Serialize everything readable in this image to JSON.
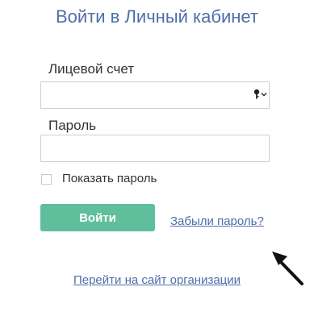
{
  "page": {
    "title": "Войти в Личный кабинет"
  },
  "form": {
    "account_label": "Лицевой счет",
    "account_value": "",
    "password_label": "Пароль",
    "password_value": "",
    "show_password_label": "Показать пароль",
    "show_password_checked": false,
    "submit_label": "Войти",
    "forgot_link": "Забыли пароль?"
  },
  "footer": {
    "org_link": "Перейти на сайт организации"
  },
  "icons": {
    "autofill": "key-icon",
    "pointer": "arrow-annotation-icon"
  },
  "colors": {
    "accent": "#4e6ea8",
    "button": "#5fbf9c",
    "text": "#333333",
    "border": "#cfcfcf"
  }
}
